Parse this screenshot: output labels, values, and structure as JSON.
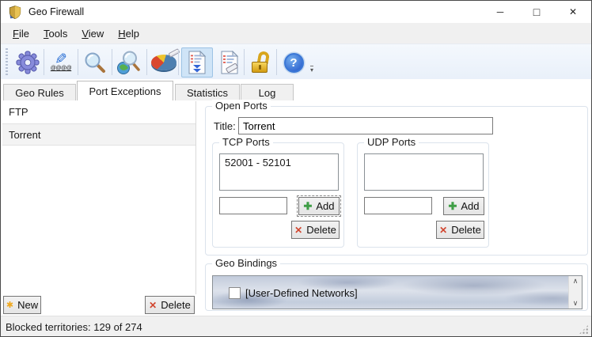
{
  "window": {
    "title": "Geo Firewall",
    "controls": {
      "minimize": "─",
      "maximize": "□",
      "close": "✕"
    }
  },
  "menu_bar": {
    "items": [
      {
        "label": "File"
      },
      {
        "label": "Tools"
      },
      {
        "label": "View"
      },
      {
        "label": "Help"
      }
    ]
  },
  "toolbar": {
    "overflow_icon": "▾",
    "buttons": [
      {
        "name": "settings"
      },
      {
        "name": "edit-rules",
        "glyph": "✎",
        "sub_text": "@@@@"
      },
      {
        "name": "search"
      },
      {
        "name": "geo-search"
      },
      {
        "name": "statistics"
      },
      {
        "name": "port-exceptions",
        "selected": true
      },
      {
        "name": "log"
      },
      {
        "name": "unlock"
      },
      {
        "name": "help",
        "glyph": "?"
      }
    ]
  },
  "tabs": [
    {
      "label": "Geo Rules",
      "active": false
    },
    {
      "label": "Port Exceptions",
      "active": true
    },
    {
      "label": "Statistics",
      "active": false
    },
    {
      "label": "Log",
      "active": false
    }
  ],
  "exceptions_panel": {
    "items": [
      {
        "label": "FTP",
        "selected": false
      },
      {
        "label": "Torrent",
        "selected": true
      }
    ],
    "new_button": {
      "label": "New",
      "icon": "✱"
    },
    "delete_button": {
      "label": "Delete",
      "icon": "✕"
    }
  },
  "open_ports": {
    "legend": "Open Ports",
    "title_label": "Title:",
    "title_value": "Torrent",
    "tcp": {
      "legend": "TCP Ports",
      "items": [
        "52001 - 52101"
      ],
      "port_input": "",
      "add_button": {
        "label": "Add",
        "icon": "✚"
      },
      "delete_button": {
        "label": "Delete",
        "icon": "✕"
      }
    },
    "udp": {
      "legend": "UDP Ports",
      "items": [],
      "port_input": "",
      "add_button": {
        "label": "Add",
        "icon": "✚"
      },
      "delete_button": {
        "label": "Delete",
        "icon": "✕"
      }
    }
  },
  "geo_bindings": {
    "legend": "Geo Bindings",
    "items": [
      {
        "label": "[User-Defined Networks]",
        "checked": false
      }
    ],
    "scrollbar": {
      "up": "∧",
      "down": "∨"
    }
  },
  "status_bar": {
    "text": "Blocked territories: 129 of 274"
  },
  "colors": {
    "toolbar_selected_bg": "#cfe4f7",
    "toolbar_selected_border": "#9cc3e5",
    "accent_blue": "#2a6fd4",
    "gold": "#e0a92c",
    "green": "#3f9e46",
    "red": "#d1452e"
  }
}
